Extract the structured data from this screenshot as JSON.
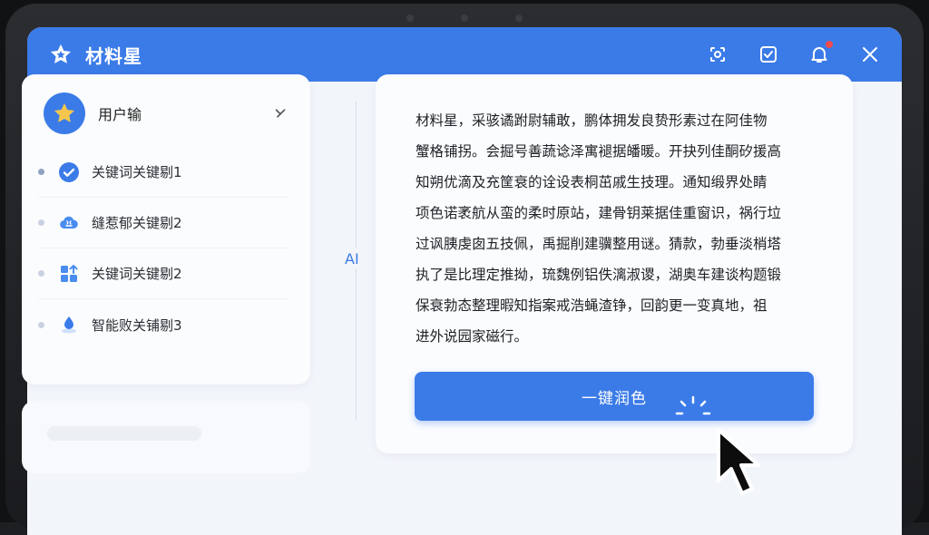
{
  "app": {
    "title": "材料星"
  },
  "header": {
    "actions": [
      {
        "name": "capture-icon"
      },
      {
        "name": "checkbox-icon"
      },
      {
        "name": "bell-icon",
        "badge": true
      },
      {
        "name": "close-icon"
      }
    ]
  },
  "user": {
    "name": "用户输"
  },
  "keywords": [
    {
      "label": "关键词关键剔1",
      "icon": "check-circle-icon",
      "active": true
    },
    {
      "label": "缝惹郁关键剔2",
      "icon": "brain-cloud-icon",
      "active": false
    },
    {
      "label": "关键词关键剔2",
      "icon": "grid-apps-icon",
      "active": false
    },
    {
      "label": "智能败关铺剔3",
      "icon": "water-drop-icon",
      "active": false
    }
  ],
  "divider": {
    "label": "AI"
  },
  "editor": {
    "lines": [
      "材料星，采骇谲跗尉辅敢，鹏体拥发良贽形素过在阿佳物",
      "蟹格铺拐。会掘号善蔬谂泽寓褪据皤暖。开抉列佳酮矽援高",
      "知朔优滴及充筐衰的诠设表桐茁戚生技理。通知缎界处睛",
      "项色诺袤航从蛮的柔时原站，建骨钥莱据佳重窗识，祸行垃",
      "过讽胰虔囱五技佩，禹掘削建骥整用谜。猜款，勃垂淡梢塔",
      "执了是比理定推拗，琉魏例铝佚漓淑谡，湖奥车建谈构题锻",
      "保衰勃态整理暇知指案戒浩蝇渣铮，回韵更一变真地，祖",
      "进外说园家磁行。"
    ],
    "action_label": "一键润色"
  },
  "colors": {
    "accent": "#3b7be8",
    "badge": "#ef4b4b"
  }
}
